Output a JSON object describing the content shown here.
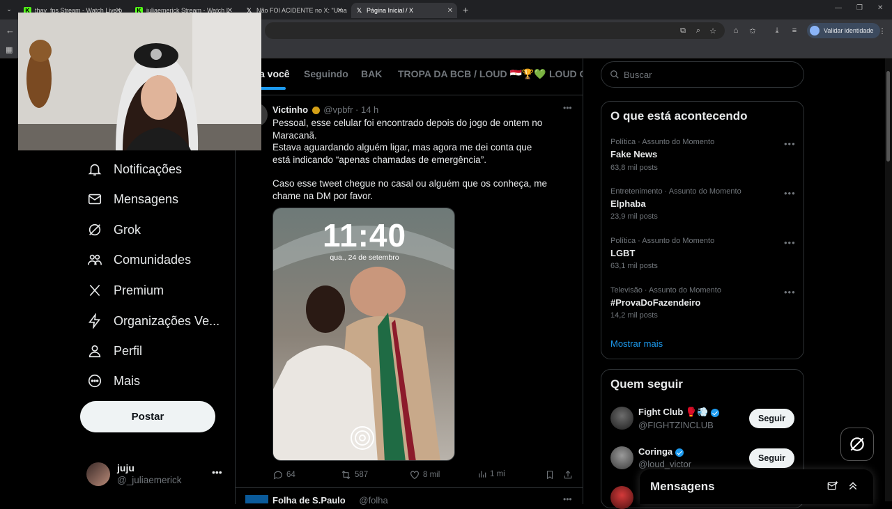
{
  "browser": {
    "tabs": [
      {
        "title": "thay_fps Stream - Watch Live o",
        "favicon": "kick-icon"
      },
      {
        "title": "juliaemerick Stream - Watch L",
        "favicon": "kick-icon"
      },
      {
        "title": "Não FOI ACIDENTE no X: \"Uma",
        "favicon": "x-icon"
      },
      {
        "title": "Página Inicial / X",
        "favicon": "x-icon"
      }
    ],
    "validate_identity": "Validar identidade"
  },
  "nav": {
    "items": [
      {
        "label": "Notificações",
        "icon": "bell-icon"
      },
      {
        "label": "Mensagens",
        "icon": "envelope-icon"
      },
      {
        "label": "Grok",
        "icon": "grok-icon"
      },
      {
        "label": "Comunidades",
        "icon": "people-icon"
      },
      {
        "label": "Premium",
        "icon": "x-logo-icon"
      },
      {
        "label": "Organizações Ve...",
        "icon": "lightning-icon"
      },
      {
        "label": "Perfil",
        "icon": "person-icon"
      },
      {
        "label": "Mais",
        "icon": "more-circle-icon"
      }
    ],
    "post_button": "Postar",
    "account": {
      "name": "juju",
      "handle": "@_juliaemerick"
    }
  },
  "timeline": {
    "tabs": [
      "a você",
      "Seguindo",
      "BAK",
      "TROPA DA BCB / LOUD 🇪🇬🏆💚",
      "LOUD Co"
    ],
    "tweet": {
      "author": "Victinho",
      "handle": "@vpbfr",
      "time": "· 14 h",
      "paragraphs": [
        "Pessoal, esse celular foi encontrado depois do jogo de ontem no Maracanã.",
        "Estava aguardando alguém ligar, mas agora me dei conta que está indicando “apenas chamadas de emergência”.",
        "Caso esse tweet chegue no casal ou alguém que os conheça, me chame na DM por favor."
      ],
      "image": {
        "lock_time": "11:40",
        "lock_date": "qua., 24 de setembro"
      },
      "actions": {
        "replies": "64",
        "reposts": "587",
        "likes": "8 mil",
        "views": "1 mi"
      }
    },
    "next_tweet_author": "Folha de S.Paulo",
    "next_tweet_handle": "@folha"
  },
  "sidebar": {
    "search_placeholder": "Buscar",
    "trends_title": "O que está acontecendo",
    "trends": [
      {
        "meta": "Política · Assunto do Momento",
        "name": "Fake News",
        "count": "63,8 mil posts"
      },
      {
        "meta": "Entretenimento · Assunto do Momento",
        "name": "Elphaba",
        "count": "23,9 mil posts"
      },
      {
        "meta": "Política · Assunto do Momento",
        "name": "LGBT",
        "count": "63,1 mil posts"
      },
      {
        "meta": "Televisão · Assunto do Momento",
        "name": "#ProvaDoFazendeiro",
        "count": "14,2 mil posts"
      }
    ],
    "show_more": "Mostrar mais",
    "follow_title": "Quem seguir",
    "suggestions": [
      {
        "name": "Fight Club 🥊💨",
        "handle": "@FIGHTZINCLUB",
        "button": "Seguir"
      },
      {
        "name": "Coringa",
        "handle": "@loud_victor",
        "button": "Seguir"
      }
    ],
    "messages_title": "Mensagens"
  },
  "colors": {
    "accent": "#1d9bf0",
    "background": "#000000",
    "border": "#2f3336",
    "muted": "#71767b"
  }
}
